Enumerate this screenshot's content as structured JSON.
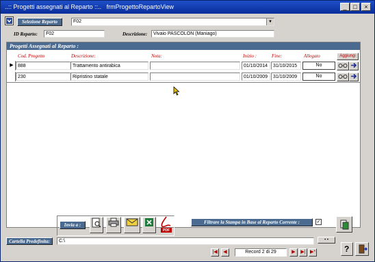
{
  "window": {
    "title": "..:: Progetti assegnati al Reparto ::..   frmProgettoRepartoView",
    "btn_min": "_",
    "btn_max": "□",
    "btn_close": "×"
  },
  "top": {
    "selezione_label": "Selezione Reparto",
    "selezione_value": "F02",
    "id_label": "ID Reparto:",
    "id_value": "F02",
    "descr_label": "Descrizione:",
    "descr_value": "Vivaio PASCOLON (Maniago)"
  },
  "panel": {
    "title": "Progetti Assegnati al Reparto :",
    "columns": {
      "cod": "Cod. Progetto",
      "descr": "Descrizione:",
      "nota": "Nota:",
      "inizio": "Inizio :",
      "fine": "Fine:",
      "allegato": "Allegato",
      "aggiungi": "Aggiungi"
    },
    "rows": [
      {
        "cod": "888",
        "descr": "Trattamento antirabica",
        "nota": "",
        "inizio": "01/10/2014",
        "fine": "31/10/2015",
        "allegato": "No",
        "marker": "▶"
      },
      {
        "cod": "230",
        "descr": "Ripristino statale",
        "nota": "",
        "inizio": "01/10/2009",
        "fine": "31/10/2009",
        "allegato": "No",
        "marker": ""
      }
    ]
  },
  "bottom": {
    "invia_label": "Invia a :",
    "filtra_label": "Filtrare la Stampa in Base al Reparto Corrente :",
    "filtra_checked": "✓",
    "cartella_label": "Cartella Predefinita:",
    "cartella_value": "C:\\",
    "browse_label": "• •",
    "record_text": "Record 2 di 29",
    "pdf_label": "PDF"
  },
  "colors": {
    "accent": "#4a6a90",
    "titlebar": "#1e4fc8",
    "column_header": "#c00000"
  }
}
